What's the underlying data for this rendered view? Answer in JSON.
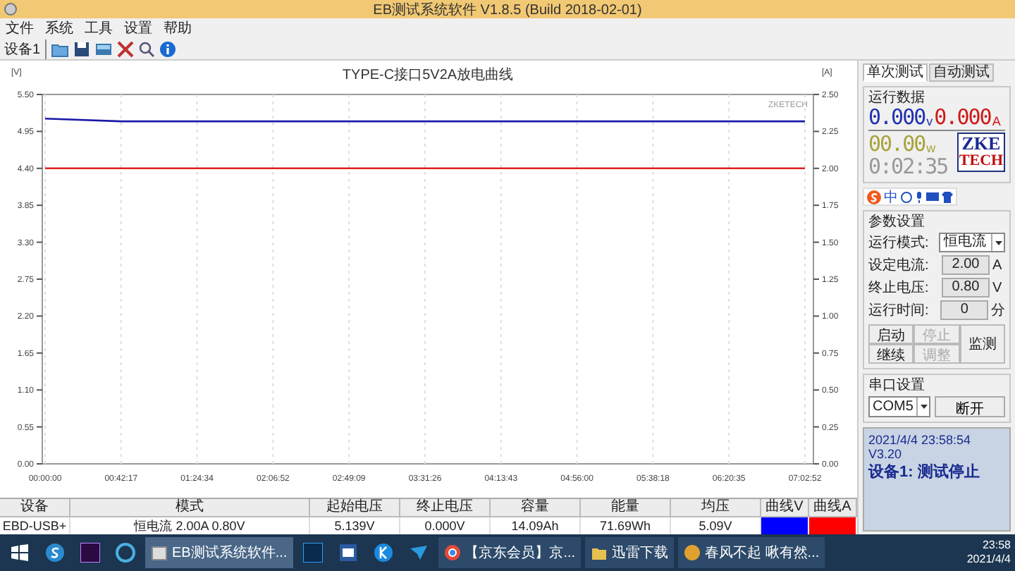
{
  "window": {
    "title": "EB测试系统软件 V1.8.5 (Build 2018-02-01)"
  },
  "menu": [
    "文件",
    "系统",
    "工具",
    "设置",
    "帮助"
  ],
  "toolbar": {
    "device_label": "设备1"
  },
  "chart": {
    "chart_data": {
      "type": "line",
      "grid": true,
      "title": "TYPE-C接口5V2A放电曲线",
      "ylabel": "[V]",
      "annotations": [
        {
          "text": "ZKETECH"
        }
      ],
      "categories": [
        "00:00:00",
        "00:42:17",
        "01:24:34",
        "02:06:52",
        "02:49:09",
        "03:31:26",
        "04:13:43",
        "04:56:00",
        "05:38:18",
        "06:20:35",
        "07:02:52"
      ],
      "ylim": [
        0,
        5.5
      ],
      "yticks": [
        {
          "value": 0,
          "label": "0.00"
        },
        {
          "value": 0.55,
          "label": "0.55"
        },
        {
          "value": 1.1,
          "label": "1.10"
        },
        {
          "value": 1.65,
          "label": "1.65"
        },
        {
          "value": 2.2,
          "label": "2.20"
        },
        {
          "value": 2.75,
          "label": "2.75"
        },
        {
          "value": 3.3,
          "label": "3.30"
        },
        {
          "value": 3.85,
          "label": "3.85"
        },
        {
          "value": 4.4,
          "label": "4.40"
        },
        {
          "value": 4.95,
          "label": "4.95"
        },
        {
          "value": 5.5,
          "label": "5.50"
        }
      ],
      "y2label": "[A]",
      "y2lim": [
        0,
        2.5
      ],
      "y2ticks": [
        {
          "value": 0,
          "label": "0.00"
        },
        {
          "value": 0.25,
          "label": "0.25"
        },
        {
          "value": 0.5,
          "label": "0.50"
        },
        {
          "value": 0.75,
          "label": "0.75"
        },
        {
          "value": 1,
          "label": "1.00"
        },
        {
          "value": 1.25,
          "label": "1.25"
        },
        {
          "value": 1.5,
          "label": "1.50"
        },
        {
          "value": 1.75,
          "label": "1.75"
        },
        {
          "value": 2,
          "label": "2.00"
        },
        {
          "value": 2.25,
          "label": "2.25"
        },
        {
          "value": 2.5,
          "label": "2.50"
        }
      ],
      "series": [
        {
          "color": "#1a1aa8",
          "values": [
            5.14,
            5.1,
            5.1,
            5.1,
            5.1,
            5.1,
            5.1,
            5.1,
            5.1,
            5.1,
            5.1
          ]
        },
        {
          "color": "#e02020",
          "axis": "y2",
          "values": [
            2.0,
            2.0,
            2.0,
            2.0,
            2.0,
            2.0,
            2.0,
            2.0,
            2.0,
            2.0,
            2.0
          ]
        }
      ]
    }
  },
  "panel": {
    "tabs": [
      {
        "label": "单次测试",
        "selected": true
      },
      {
        "label": "自动测试",
        "selected": false
      }
    ],
    "run_data": {
      "title": "运行数据",
      "voltage": "0.000",
      "voltage_unit": "v",
      "current": "0.000",
      "current_unit": "A",
      "power": "00.00",
      "power_unit": "w",
      "timer": "0:02:35",
      "logo_top": "ZKE",
      "logo_bottom": "TECH"
    },
    "params": {
      "title": "参数设置",
      "rows": [
        {
          "kind": "select",
          "label": "运行模式:",
          "value": "恒电流"
        },
        {
          "kind": "input",
          "label": "设定电流:",
          "value": "2.00",
          "unit": "A"
        },
        {
          "kind": "input",
          "label": "终止电压:",
          "value": "0.80",
          "unit": "V"
        },
        {
          "kind": "input",
          "label": "运行时间:",
          "value": "0",
          "unit": "分"
        }
      ],
      "buttons": [
        {
          "label": "启动",
          "disabled": false
        },
        {
          "label": "停止",
          "disabled": true
        },
        {
          "label": "继续",
          "disabled": false
        },
        {
          "label": "调整",
          "disabled": true
        }
      ],
      "monitor_button": "监测"
    },
    "serial": {
      "title": "串口设置",
      "port": "COM5",
      "button": "断开"
    },
    "status": {
      "line_1": "2021/4/4 23:58:54  V3.20",
      "line_2": "设备1: 测试停止"
    }
  },
  "ime_toolbar": {
    "label": "中"
  },
  "table": {
    "columns": [
      "设备",
      "模式",
      "起始电压",
      "终止电压",
      "容量",
      "能量",
      "均压",
      "曲线V",
      "曲线A"
    ],
    "rows": [
      {
        "cells": [
          "EBD-USB+",
          "恒电流 2.00A 0.80V",
          "5.139V",
          "0.000V",
          "14.09Ah",
          "71.69Wh",
          "5.09V"
        ],
        "curves": [
          {
            "color": "#0000ff"
          },
          {
            "color": "#ff0000"
          }
        ]
      }
    ]
  },
  "taskbar": {
    "items": [
      {
        "kind": "start"
      },
      {
        "kind": "icon"
      },
      {
        "kind": "icon"
      },
      {
        "kind": "icon"
      },
      {
        "kind": "window",
        "label": "EB测试系统软件...",
        "active": true
      },
      {
        "kind": "icon"
      },
      {
        "kind": "icon"
      },
      {
        "kind": "icon"
      },
      {
        "kind": "icon"
      },
      {
        "kind": "window",
        "label": "【京东会员】京...",
        "active": false
      },
      {
        "kind": "window",
        "label": "迅雷下载",
        "active": false
      },
      {
        "kind": "window",
        "label": "春风不起 啾有然...",
        "active": false
      }
    ],
    "clock_time": "23:58",
    "clock_date": "2021/4/4"
  }
}
